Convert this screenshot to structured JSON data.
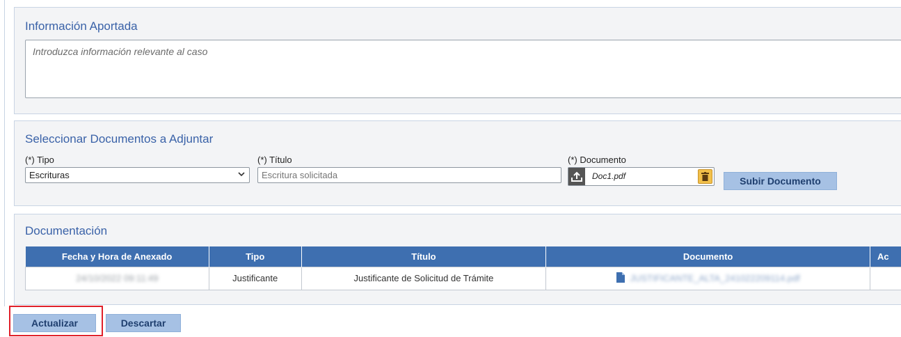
{
  "info_panel": {
    "title": "Información Aportada",
    "textarea_placeholder": "Introduzca información relevante al caso",
    "textarea_value": ""
  },
  "select_docs_panel": {
    "title": "Seleccionar Documentos a Adjuntar",
    "tipo_label": "(*) Tipo",
    "tipo_value": "Escrituras",
    "titulo_label": "(*) Título",
    "titulo_placeholder": "Escritura solicitada",
    "documento_label": "(*) Documento",
    "document_file_name": "Doc1.pdf",
    "upload_button": "Subir Documento"
  },
  "documentation_panel": {
    "title": "Documentación",
    "columns": [
      "Fecha y Hora de Anexado",
      "Tipo",
      "Título",
      "Documento",
      "Ac"
    ],
    "rows": [
      {
        "fecha": "24/10/2022 09:11:49",
        "tipo": "Justificante",
        "titulo": "Justificante de Solicitud de Trámite",
        "documento": "JUSTIFICANTE_ALTA_241022209114.pdf",
        "accion": ""
      }
    ]
  },
  "actions": {
    "update_button": "Actualizar",
    "discard_button": "Descartar"
  },
  "colors": {
    "accent_title": "#3a62a8",
    "table_header": "#3e6fb0",
    "button_bg": "#a6c1e4",
    "highlight": "#e0202a"
  }
}
